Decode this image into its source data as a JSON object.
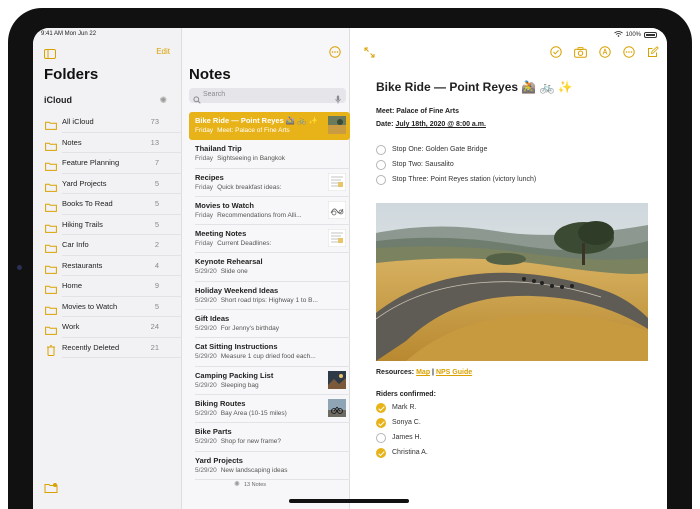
{
  "status": {
    "time": "9:41 AM  Mon Jun 22",
    "battery": "100%"
  },
  "folders": {
    "title": "Folders",
    "edit_label": "Edit",
    "section": "iCloud",
    "items": [
      {
        "name": "All iCloud",
        "count": "73",
        "icon": "folder-icon"
      },
      {
        "name": "Notes",
        "count": "13",
        "icon": "folder-icon"
      },
      {
        "name": "Feature Planning",
        "count": "7",
        "icon": "folder-icon"
      },
      {
        "name": "Yard Projects",
        "count": "5",
        "icon": "folder-icon"
      },
      {
        "name": "Books To Read",
        "count": "5",
        "icon": "folder-icon"
      },
      {
        "name": "Hiking Trails",
        "count": "5",
        "icon": "folder-icon"
      },
      {
        "name": "Car Info",
        "count": "2",
        "icon": "folder-icon"
      },
      {
        "name": "Restaurants",
        "count": "4",
        "icon": "folder-icon"
      },
      {
        "name": "Home",
        "count": "9",
        "icon": "folder-icon"
      },
      {
        "name": "Movies to Watch",
        "count": "5",
        "icon": "folder-icon"
      },
      {
        "name": "Work",
        "count": "24",
        "icon": "folder-icon"
      },
      {
        "name": "Recently Deleted",
        "count": "21",
        "icon": "trash-icon"
      }
    ]
  },
  "notes": {
    "title": "Notes",
    "search_placeholder": "Search",
    "count_label": "13 Notes",
    "items": [
      {
        "title": "Bike Ride — Point Reyes 🚵 🚲 ✨",
        "date": "Friday",
        "snippet": "Meet: Palace of Fine Arts",
        "selected": true,
        "thumb": "photo"
      },
      {
        "title": "Thailand Trip",
        "date": "Friday",
        "snippet": "Sightseeing in Bangkok",
        "selected": false,
        "thumb": ""
      },
      {
        "title": "Recipes",
        "date": "Friday",
        "snippet": "Quick breakfast ideas:",
        "selected": false,
        "thumb": "doc"
      },
      {
        "title": "Movies to Watch",
        "date": "Friday",
        "snippet": "Recommendations from Alli...",
        "selected": false,
        "thumb": "sketch"
      },
      {
        "title": "Meeting Notes",
        "date": "Friday",
        "snippet": "Current Deadlines:",
        "selected": false,
        "thumb": "doc"
      },
      {
        "title": "Keynote Rehearsal",
        "date": "5/29/20",
        "snippet": "Slide one",
        "selected": false,
        "thumb": ""
      },
      {
        "title": "Holiday Weekend Ideas",
        "date": "5/29/20",
        "snippet": "Short road trips: Highway 1 to B...",
        "selected": false,
        "thumb": ""
      },
      {
        "title": "Gift Ideas",
        "date": "5/29/20",
        "snippet": "For Jenny's birthday",
        "selected": false,
        "thumb": ""
      },
      {
        "title": "Cat Sitting Instructions",
        "date": "5/29/20",
        "snippet": "Measure 1 cup dried food each...",
        "selected": false,
        "thumb": ""
      },
      {
        "title": "Camping Packing List",
        "date": "5/29/20",
        "snippet": "Sleeping bag",
        "selected": false,
        "thumb": "photo-dark"
      },
      {
        "title": "Biking Routes",
        "date": "5/29/20",
        "snippet": "Bay Area (10-15 miles)",
        "selected": false,
        "thumb": "photo-bike"
      },
      {
        "title": "Bike Parts",
        "date": "5/29/20",
        "snippet": "Shop for new frame?",
        "selected": false,
        "thumb": ""
      },
      {
        "title": "Yard Projects",
        "date": "5/29/20",
        "snippet": "New landscaping ideas",
        "selected": false,
        "thumb": ""
      }
    ]
  },
  "editor": {
    "title": "Bike Ride — Point Reyes 🚵 🚲 ✨",
    "meet": "Meet: Palace of Fine Arts",
    "date_prefix": "Date: ",
    "date_value": "July 18th, 2020 @ 8:00 a.m.",
    "stops": [
      {
        "text": "Stop One: Golden Gate Bridge",
        "checked": false
      },
      {
        "text": "Stop Two: Sausalito",
        "checked": false
      },
      {
        "text": "Stop Three: Point Reyes station (victory lunch)",
        "checked": false
      }
    ],
    "resources_label": "Resources:",
    "link_map": "Map",
    "link_sep": " | ",
    "link_nps": "NPS Guide",
    "riders_label": "Riders confirmed:",
    "riders": [
      {
        "text": "Mark R.",
        "checked": true
      },
      {
        "text": "Sonya C.",
        "checked": true
      },
      {
        "text": "James H.",
        "checked": false
      },
      {
        "text": "Christina A.",
        "checked": true
      }
    ]
  },
  "colors": {
    "accent": "#e8b319",
    "link": "#d9a100"
  }
}
